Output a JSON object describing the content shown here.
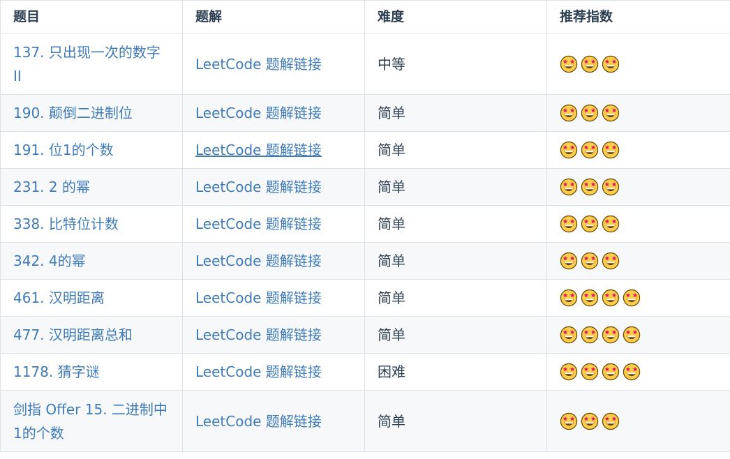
{
  "table": {
    "headers": [
      "题目",
      "题解",
      "难度",
      "推荐指数"
    ],
    "rows": [
      {
        "title": "137. 只出现一次的数字 II",
        "solution": "LeetCode 题解链接",
        "difficulty": "中等",
        "stars": 3,
        "tall": true
      },
      {
        "title": "190. 颠倒二进制位",
        "solution": "LeetCode 题解链接",
        "difficulty": "简单",
        "stars": 3
      },
      {
        "title": "191. 位1的个数",
        "solution": "LeetCode 题解链接",
        "difficulty": "简单",
        "stars": 3,
        "underline": true
      },
      {
        "title": "231. 2 的幂",
        "solution": "LeetCode 题解链接",
        "difficulty": "简单",
        "stars": 3
      },
      {
        "title": "338. 比特位计数",
        "solution": "LeetCode 题解链接",
        "difficulty": "简单",
        "stars": 3
      },
      {
        "title": "342. 4的幂",
        "solution": "LeetCode 题解链接",
        "difficulty": "简单",
        "stars": 3
      },
      {
        "title": "461. 汉明距离",
        "solution": "LeetCode 题解链接",
        "difficulty": "简单",
        "stars": 4
      },
      {
        "title": "477. 汉明距离总和",
        "solution": "LeetCode 题解链接",
        "difficulty": "简单",
        "stars": 4
      },
      {
        "title": "1178. 猜字谜",
        "solution": "LeetCode 题解链接",
        "difficulty": "困难",
        "stars": 4
      },
      {
        "title": "剑指 Offer 15. 二进制中1的个数",
        "solution": "LeetCode 题解链接",
        "difficulty": "简单",
        "stars": 3,
        "tall": true
      }
    ],
    "colors": {
      "link": "#3f7ab8",
      "text": "#2c3e50",
      "border": "#dfe2e5",
      "stripe": "#f6f8fa"
    },
    "rating_icon": "star-struck-emoji-icon"
  }
}
